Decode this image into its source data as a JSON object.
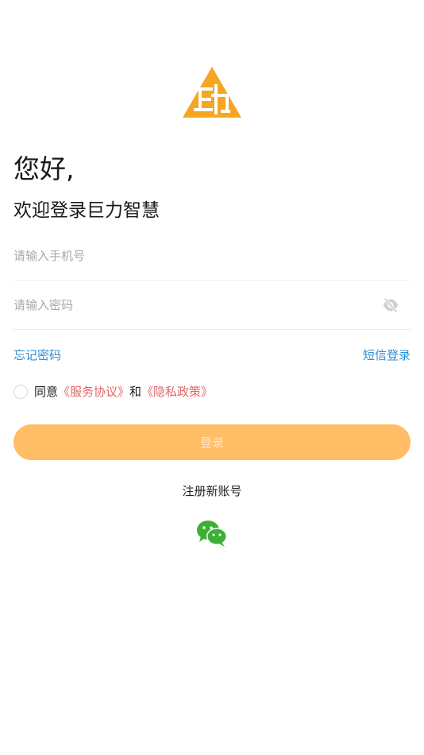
{
  "brand": {
    "logo_icon": "brand-logo-icon",
    "accent_color": "#F5A623"
  },
  "header": {
    "greeting": "您好,",
    "welcome": "欢迎登录巨力智慧"
  },
  "form": {
    "phone_placeholder": "请输入手机号",
    "password_placeholder": "请输入密码",
    "password_visibility_icon": "eye-off-icon",
    "forgot_password": "忘记密码",
    "sms_login": "短信登录"
  },
  "agreement": {
    "prefix": "同意",
    "service_agreement": "《服务协议》",
    "conjunction": "和",
    "privacy_policy": "《隐私政策》"
  },
  "actions": {
    "login_label": "登录",
    "login_color": "#FFBD66",
    "register_label": "注册新账号",
    "wechat_icon": "wechat-icon",
    "wechat_color": "#3CB035"
  }
}
